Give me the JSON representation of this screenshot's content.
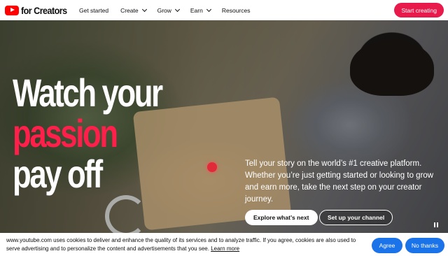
{
  "header": {
    "logo_text": "for Creators",
    "nav": [
      {
        "label": "Get started"
      },
      {
        "label": "Create"
      },
      {
        "label": "Grow"
      },
      {
        "label": "Earn"
      },
      {
        "label": "Resources"
      }
    ],
    "cta_label": "Start creating"
  },
  "hero": {
    "headline_line1": "Watch your",
    "headline_line2": "passion",
    "headline_line3": "pay off",
    "tagline": "Tell your story on the world’s #1 creative platform. Whether you’re just getting started or looking to grow and earn more, take the next step on your creator journey.",
    "explore_label": "Explore what’s next",
    "setup_label": "Set up your channel"
  },
  "cookie": {
    "text": "www.youtube.com uses cookies to deliver and enhance the quality of its services and to analyze traffic. If you agree, cookies are also used to serve advertising and to personalize the content and advertisements that you see.",
    "learn_more": "Learn more",
    "agree_label": "Agree",
    "no_thanks_label": "No thanks"
  },
  "colors": {
    "brand_red": "#ff0000",
    "cta_pink": "#e8194b",
    "headline_red": "#ff1f4b",
    "button_blue": "#1a73e8"
  }
}
